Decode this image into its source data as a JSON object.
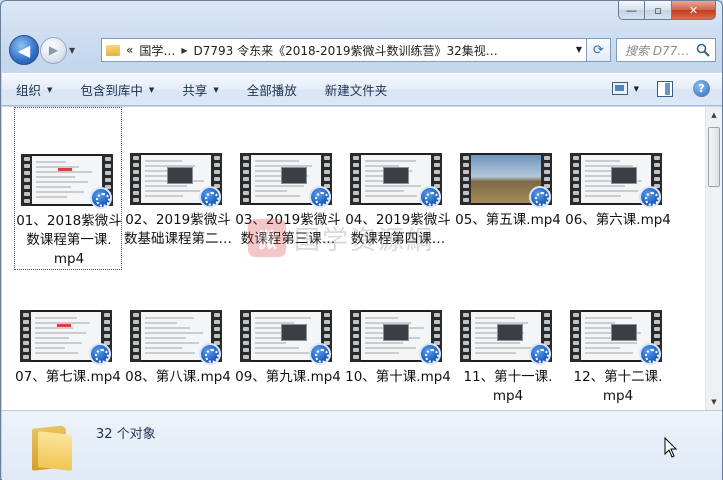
{
  "window": {
    "caption_minimize": "—",
    "caption_maximize": "▫",
    "caption_close": "✕"
  },
  "nav": {
    "back_icon": "back-arrow-icon",
    "forward_icon": "forward-arrow-icon",
    "breadcrumb_overflow": "«",
    "breadcrumbs": [
      "国学…",
      "D7793 令东来《2018-2019紫微斗数训练营》32集视…"
    ],
    "search_placeholder": "搜索 D77…"
  },
  "toolbar": {
    "organize": "组织",
    "include_library": "包含到库中",
    "share": "共享",
    "play_all": "全部播放",
    "new_folder": "新建文件夹",
    "help": "?"
  },
  "files": [
    {
      "name": "01、2018紫微斗\n数课程第一课.\nmp4",
      "selected": true,
      "style": "doc-red"
    },
    {
      "name": "02、2019紫微斗\n数基础课程第二…",
      "selected": false,
      "style": "dialog"
    },
    {
      "name": "03、2019紫微斗\n数课程第三课…",
      "selected": false,
      "style": "dialog"
    },
    {
      "name": "04、2019紫微斗\n数课程第四课…",
      "selected": false,
      "style": "dialog"
    },
    {
      "name": "05、第五课.mp4",
      "selected": false,
      "style": "scenic"
    },
    {
      "name": "06、第六课.mp4",
      "selected": false,
      "style": "dialog"
    },
    {
      "name": "07、第七课.mp4",
      "selected": false,
      "style": "doc-red"
    },
    {
      "name": "08、第八课.mp4",
      "selected": false,
      "style": "doc"
    },
    {
      "name": "09、第九课.mp4",
      "selected": false,
      "style": "dialog"
    },
    {
      "name": "10、第十课.mp4",
      "selected": false,
      "style": "dialog"
    },
    {
      "name": "11、第十一课.\nmp4",
      "selected": false,
      "style": "dialog"
    },
    {
      "name": "12、第十二课.\nmp4",
      "selected": false,
      "style": "dialog"
    }
  ],
  "watermark": {
    "logo": "微",
    "text": "国学资源網"
  },
  "details": {
    "count": "32 个对象"
  }
}
